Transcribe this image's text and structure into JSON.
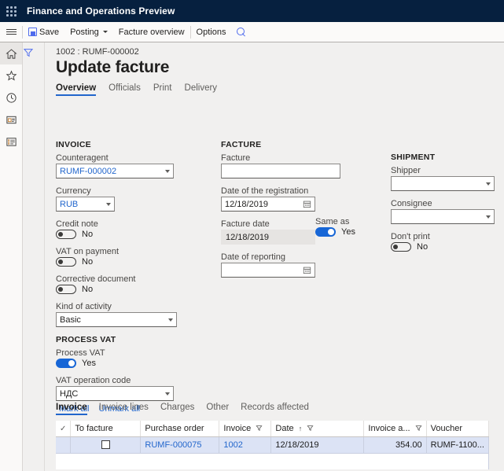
{
  "titlebar": {
    "waffle_icon": "app-launcher-icon",
    "app_title": "Finance and Operations Preview"
  },
  "commandbar": {
    "hamburger_icon": "hamburger-icon",
    "save_label": "Save",
    "save_icon": "save-icon",
    "posting_label": "Posting",
    "posting_chevron_icon": "chevron-down-icon",
    "facture_overview_label": "Facture overview",
    "options_label": "Options",
    "search_icon": "search-icon"
  },
  "rail": {
    "items": [
      {
        "name": "home",
        "icon": "home-icon"
      },
      {
        "name": "favorites",
        "icon": "star-icon"
      },
      {
        "name": "recent",
        "icon": "clock-icon"
      },
      {
        "name": "workspaces",
        "icon": "workspace-icon"
      },
      {
        "name": "modules",
        "icon": "list-icon"
      }
    ],
    "filter_icon": "filter-funnel-icon"
  },
  "page": {
    "breadcrumb": "1002 : RUMF-000002",
    "title": "Update facture",
    "tabs": [
      {
        "label": "Overview",
        "active": true
      },
      {
        "label": "Officials",
        "active": false
      },
      {
        "label": "Print",
        "active": false
      },
      {
        "label": "Delivery",
        "active": false
      }
    ]
  },
  "invoice": {
    "section_title": "INVOICE",
    "counteragent": {
      "label": "Counteragent",
      "value": "RUMF-000002"
    },
    "currency": {
      "label": "Currency",
      "value": "RUB"
    },
    "credit_note": {
      "label": "Credit note",
      "value": "No",
      "on": false
    },
    "vat_on_payment": {
      "label": "VAT on payment",
      "value": "No",
      "on": false
    },
    "corrective_document": {
      "label": "Corrective document",
      "value": "No",
      "on": false
    },
    "kind_of_activity": {
      "label": "Kind of activity",
      "value": "Basic"
    }
  },
  "process_vat": {
    "section_title": "PROCESS VAT",
    "process_vat": {
      "label": "Process VAT",
      "value": "Yes",
      "on": true
    },
    "vat_operation_code": {
      "label": "VAT operation code",
      "value": "НДС"
    },
    "mark_all_label": "Mark all",
    "unmark_all_label": "Unmark all"
  },
  "facture": {
    "section_title": "FACTURE",
    "facture": {
      "label": "Facture",
      "value": ""
    },
    "date_of_registration": {
      "label": "Date of the registration",
      "value": "12/18/2019",
      "icon": "calendar-icon"
    },
    "facture_date": {
      "label": "Facture date",
      "value": "12/18/2019"
    },
    "date_of_reporting": {
      "label": "Date of reporting",
      "value": "",
      "icon": "calendar-icon"
    },
    "same_as": {
      "label": "Same as",
      "value": "Yes",
      "on": true
    }
  },
  "shipment": {
    "section_title": "SHIPMENT",
    "shipper": {
      "label": "Shipper",
      "value": ""
    },
    "consignee": {
      "label": "Consignee",
      "value": ""
    },
    "dont_print": {
      "label": "Don't print",
      "value": "No",
      "on": false
    }
  },
  "grid": {
    "tabs": [
      {
        "label": "Invoice",
        "active": true
      },
      {
        "label": "Invoice lines",
        "active": false
      },
      {
        "label": "Charges",
        "active": false
      },
      {
        "label": "Other",
        "active": false
      },
      {
        "label": "Records affected",
        "active": false
      }
    ],
    "columns": [
      {
        "label": "",
        "icon": "check-header-icon",
        "filter": false,
        "sort": ""
      },
      {
        "label": "To facture",
        "filter": false,
        "sort": ""
      },
      {
        "label": "Purchase order",
        "filter": false,
        "sort": ""
      },
      {
        "label": "Invoice",
        "filter": true,
        "sort": ""
      },
      {
        "label": "Date",
        "filter": true,
        "sort": "asc"
      },
      {
        "label": "Invoice a...",
        "filter": true,
        "sort": ""
      },
      {
        "label": "Voucher",
        "filter": false,
        "sort": ""
      }
    ],
    "rows": [
      {
        "checkbox": false,
        "to_facture": "",
        "purchase_order": "RUMF-000075",
        "invoice": "1002",
        "date": "12/18/2019",
        "invoice_amount": "354.00",
        "voucher": "RUMF-1100..."
      }
    ]
  },
  "colors": {
    "titlebar_bg": "#06203f",
    "accent": "#2266cc",
    "toggle_on": "#1766d6",
    "canvas": "#f1f0ef",
    "row_selected": "#dce3f5"
  }
}
